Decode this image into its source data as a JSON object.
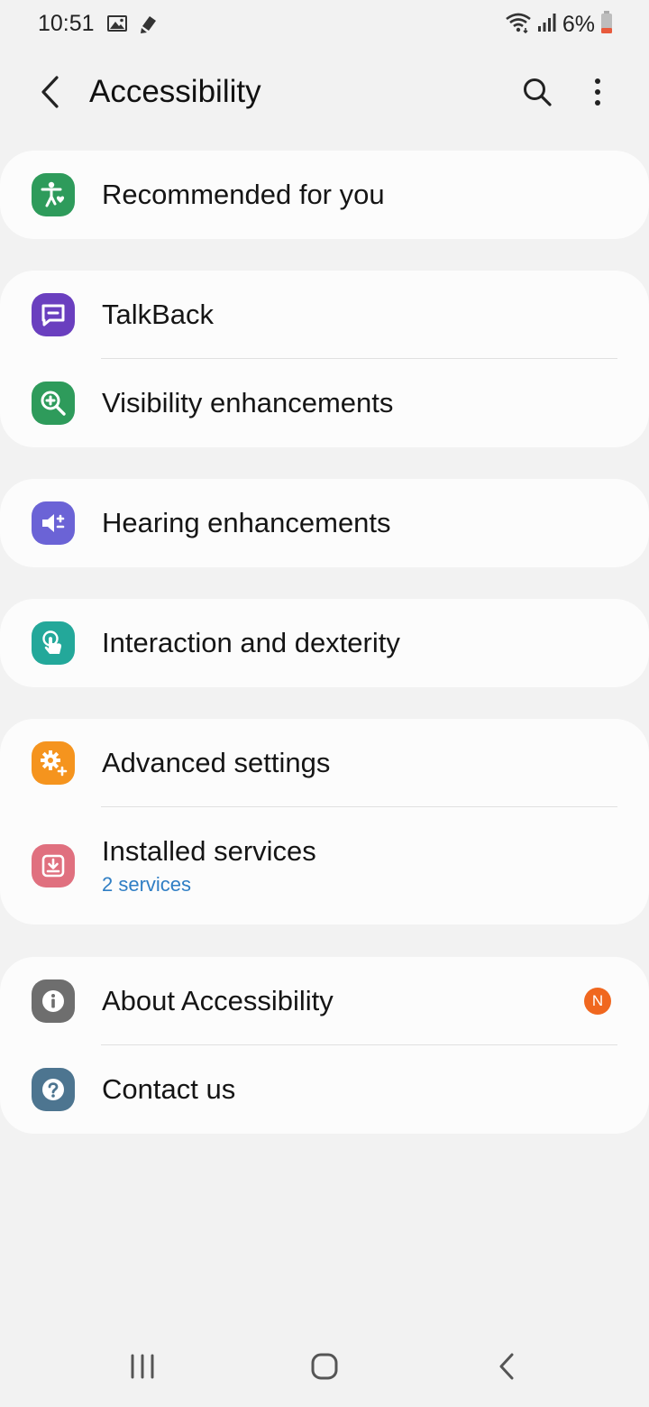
{
  "status_bar": {
    "time": "10:51",
    "battery": "6%",
    "icons": [
      "image-icon",
      "pen-notification-icon",
      "wifi-icon",
      "signal-icon",
      "battery-low-icon"
    ]
  },
  "app_bar": {
    "title": "Accessibility",
    "back_icon": "back-arrow-icon",
    "search_icon": "search-icon",
    "more_icon": "more-vertical-icon"
  },
  "groups": [
    {
      "items": [
        {
          "label": "Recommended for you",
          "icon": "accessibility-person-icon",
          "color": "#2e9b5b"
        }
      ]
    },
    {
      "items": [
        {
          "label": "TalkBack",
          "icon": "talkback-chat-icon",
          "color": "#6a3fbf"
        },
        {
          "label": "Visibility enhancements",
          "icon": "magnifier-plus-icon",
          "color": "#2e9b5b"
        }
      ]
    },
    {
      "items": [
        {
          "label": "Hearing enhancements",
          "icon": "speaker-plus-icon",
          "color": "#6b63d6"
        }
      ]
    },
    {
      "items": [
        {
          "label": "Interaction and dexterity",
          "icon": "hand-touch-icon",
          "color": "#23a89a"
        }
      ]
    },
    {
      "items": [
        {
          "label": "Advanced settings",
          "icon": "gear-plus-icon",
          "color": "#f5941e"
        },
        {
          "label": "Installed services",
          "sublabel": "2 services",
          "icon": "download-box-icon",
          "color": "#e0707f"
        }
      ]
    },
    {
      "items": [
        {
          "label": "About Accessibility",
          "icon": "info-icon",
          "color": "#6e6e6e",
          "badge": "N"
        },
        {
          "label": "Contact us",
          "icon": "question-icon",
          "color": "#4d7590"
        }
      ]
    }
  ],
  "nav_bar": {
    "recents_icon": "recents-icon",
    "home_icon": "home-icon",
    "back_icon": "nav-back-icon"
  }
}
